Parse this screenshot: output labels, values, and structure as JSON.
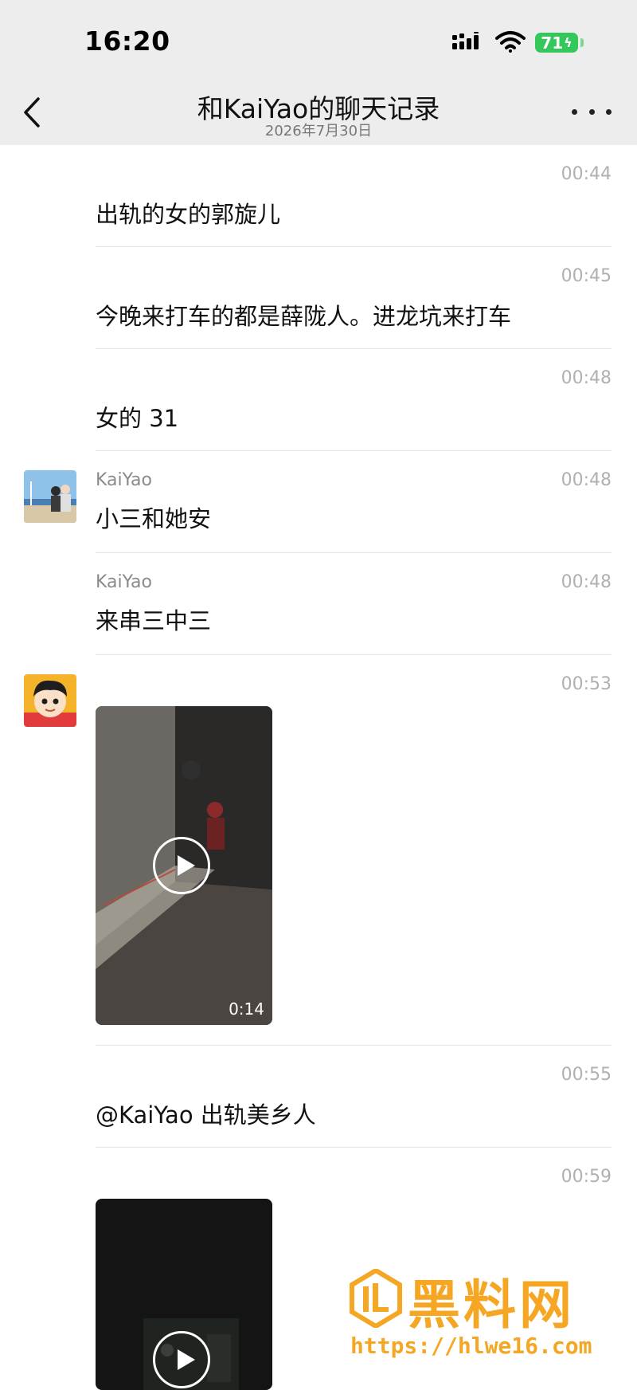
{
  "status_bar": {
    "time": "16:20",
    "battery": "71"
  },
  "header": {
    "title": "和KaiYao的聊天记录",
    "subtitle": "2026年7月30日"
  },
  "messages": [
    {
      "time": "00:44",
      "text": "出轨的女的郭旋儿"
    },
    {
      "time": "00:45",
      "text": "今晚来打车的都是薛陇人。进龙坑来打车"
    },
    {
      "time": "00:48",
      "text": "女的 31"
    },
    {
      "time": "00:48",
      "sender": "KaiYao",
      "text": "小三和她安"
    },
    {
      "time": "00:48",
      "sender": "KaiYao",
      "text": "来串三中三"
    },
    {
      "time": "00:53",
      "video_duration": "0:14"
    },
    {
      "time": "00:55",
      "text": "@KaiYao 出轨美乡人"
    },
    {
      "time": "00:59"
    }
  ],
  "watermark": {
    "brand": "黑料网",
    "url": "https://hlwe16.com"
  },
  "colors": {
    "header_bg": "#ededed",
    "battery": "#34c759",
    "watermark": "#f5a623"
  }
}
